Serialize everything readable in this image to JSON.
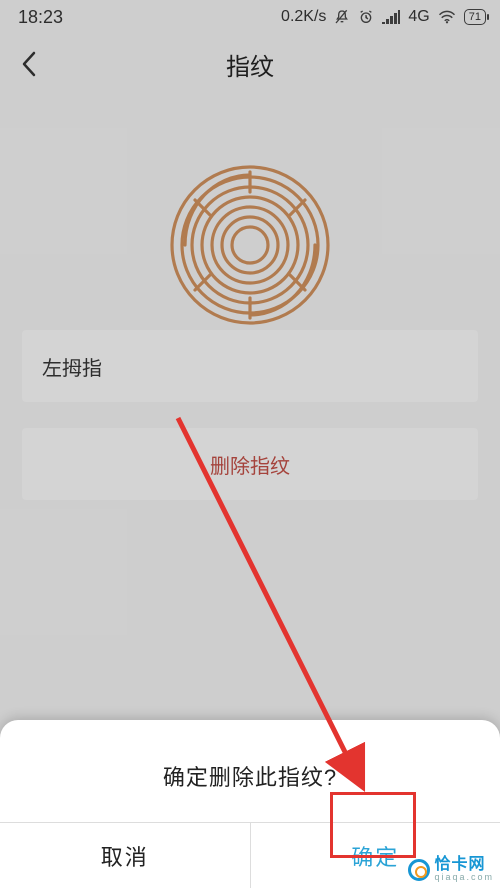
{
  "status": {
    "time": "18:23",
    "net_speed": "0.2K/s",
    "network_label": "4G",
    "battery_text": "71"
  },
  "header": {
    "title": "指纹"
  },
  "fingerprint": {
    "name": "左拇指",
    "delete_label": "删除指纹"
  },
  "dialog": {
    "message": "确定删除此指纹?",
    "cancel_label": "取消",
    "confirm_label": "确定"
  },
  "watermark": {
    "name_cn": "恰卡网",
    "name_en": "qiaqa.com"
  },
  "colors": {
    "danger": "#b84b43",
    "accent": "#2aa3d6",
    "annotation": "#e3342f",
    "fingerprint": "#c68a58"
  }
}
